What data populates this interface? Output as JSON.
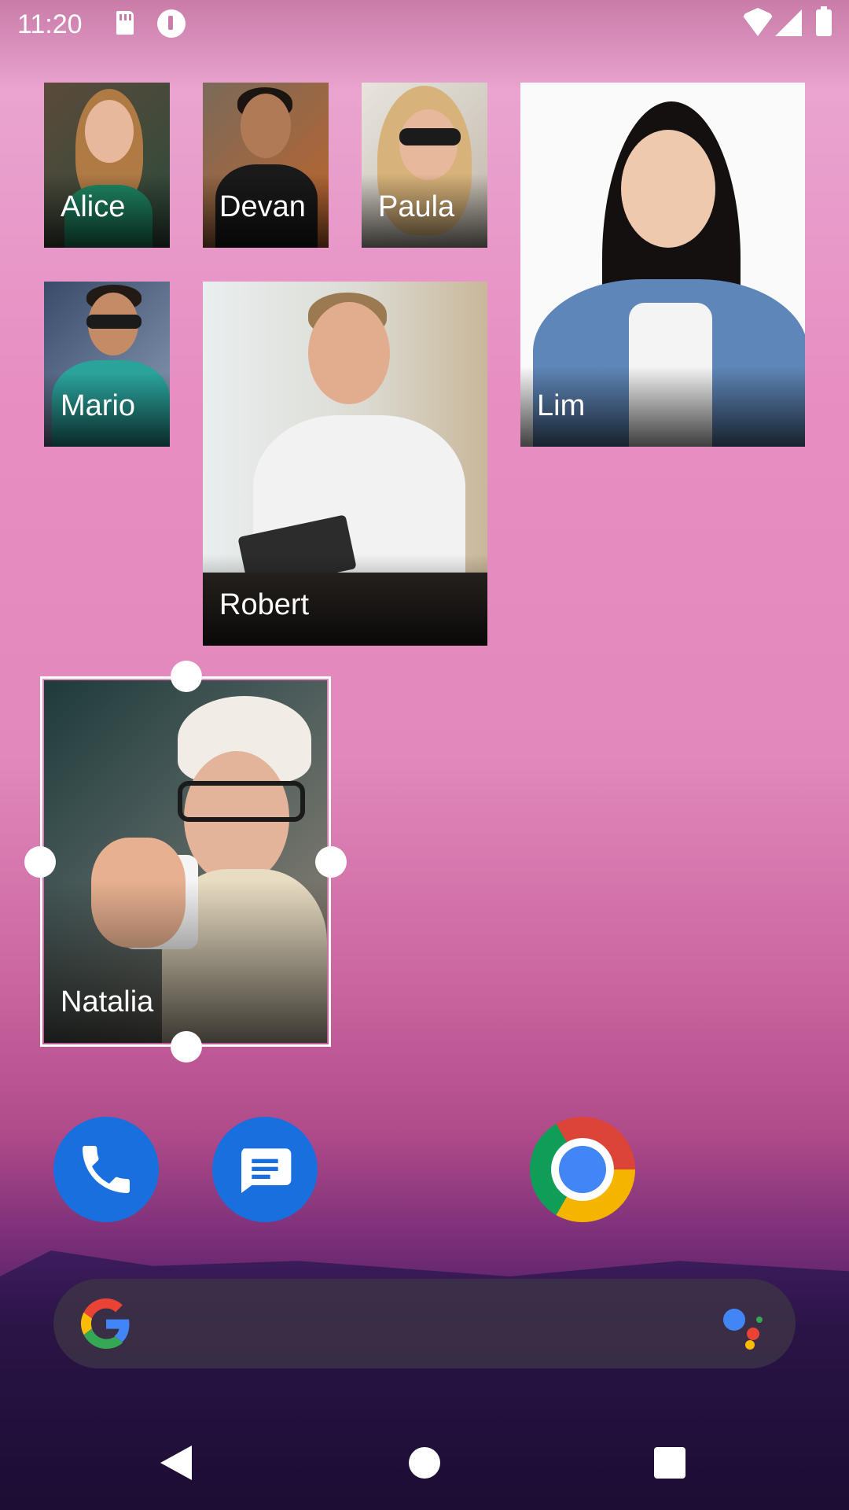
{
  "status_bar": {
    "time": "11:20",
    "icons": [
      "sd-card-icon",
      "notification-p-icon",
      "wifi-icon",
      "signal-icon",
      "battery-icon"
    ]
  },
  "contacts": [
    {
      "id": "alice",
      "name": "Alice"
    },
    {
      "id": "devan",
      "name": "Devan"
    },
    {
      "id": "paula",
      "name": "Paula"
    },
    {
      "id": "lim",
      "name": "Lim"
    },
    {
      "id": "mario",
      "name": "Mario"
    },
    {
      "id": "robert",
      "name": "Robert"
    },
    {
      "id": "natalia",
      "name": "Natalia",
      "selected": true
    }
  ],
  "dock": {
    "apps": [
      "phone-app",
      "messages-app",
      "chrome-app"
    ]
  },
  "search": {
    "icons": [
      "google-logo-icon",
      "google-assistant-icon"
    ]
  },
  "nav": {
    "buttons": [
      "back-button",
      "home-button",
      "recents-button"
    ]
  },
  "colors": {
    "accent_blue": "#1a6fdf",
    "wallpaper_top": "#e9a4cf",
    "wallpaper_bottom": "#22103c"
  }
}
